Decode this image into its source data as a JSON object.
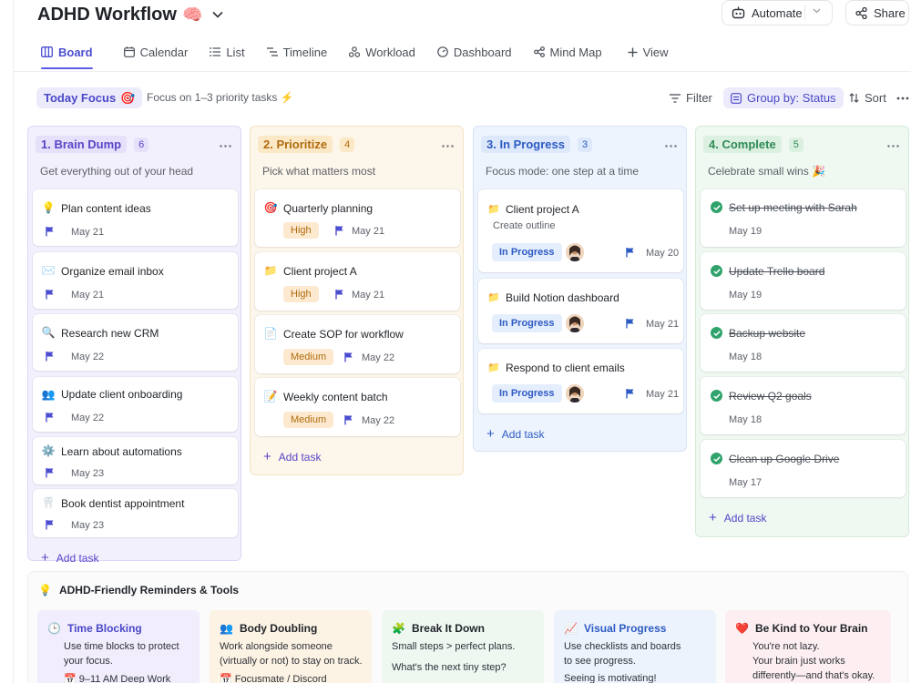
{
  "header": {
    "title": "ADHD Workflow",
    "emoji": "🧠",
    "automate_label": "Automate",
    "share_label": "Share"
  },
  "tabs": [
    {
      "label": "Board",
      "icon": "board-icon",
      "active": true
    },
    {
      "label": "Calendar",
      "icon": "calendar-icon"
    },
    {
      "label": "List",
      "icon": "list-icon"
    },
    {
      "label": "Timeline",
      "icon": "timeline-icon"
    },
    {
      "label": "Workload",
      "icon": "workload-icon"
    },
    {
      "label": "Dashboard",
      "icon": "dashboard-icon"
    },
    {
      "label": "Mind Map",
      "icon": "mindmap-icon"
    },
    {
      "label": "View",
      "icon": "plus-icon"
    }
  ],
  "toolbar": {
    "focus_label": "Today Focus",
    "focus_emoji": "🎯",
    "focus_text": "Focus on 1–3 priority tasks ⚡",
    "filter_label": "Filter",
    "group_label": "Group by: Status",
    "sort_label": "Sort"
  },
  "columns": [
    {
      "name": "1. Brain Dump",
      "count": "6",
      "subtitle": "Get everything out of your head",
      "cards": [
        {
          "icon": "💡",
          "title": "Plan content ideas",
          "date": "May 21"
        },
        {
          "icon": "✉️",
          "title": "Organize email inbox",
          "date": "May 21"
        },
        {
          "icon": "🔍",
          "title": "Research new CRM",
          "date": "May 22"
        },
        {
          "icon": "👥",
          "title": "Update client onboarding",
          "date": "May 22"
        },
        {
          "icon": "⚙️",
          "title": "Learn about automations",
          "date": "May 23"
        },
        {
          "icon": "🦷",
          "title": "Book dentist appointment",
          "date": "May 23"
        }
      ],
      "add_label": "Add task"
    },
    {
      "name": "2. Prioritize",
      "count": "4",
      "subtitle": "Pick what matters most",
      "cards": [
        {
          "icon": "🎯",
          "title": "Quarterly planning",
          "priority": "High",
          "date": "May 21"
        },
        {
          "icon": "📁",
          "title": "Client project A",
          "priority": "High",
          "date": "May 21"
        },
        {
          "icon": "📄",
          "title": "Create SOP for workflow",
          "priority": "Medium",
          "date": "May 22"
        },
        {
          "icon": "📝",
          "title": "Weekly content batch",
          "priority": "Medium",
          "date": "May 22"
        }
      ],
      "add_label": "Add task"
    },
    {
      "name": "3. In Progress",
      "count": "3",
      "subtitle": "Focus mode: one step at a time",
      "cards": [
        {
          "icon": "📁",
          "title": "Client project A",
          "description": "Create outline",
          "status": "In Progress",
          "date": "May 20"
        },
        {
          "icon": "📁",
          "title": "Build Notion dashboard",
          "status": "In Progress",
          "date": "May 21"
        },
        {
          "icon": "📁",
          "title": "Respond to client emails",
          "status": "In Progress",
          "date": "May 21"
        }
      ],
      "add_label": "Add task"
    },
    {
      "name": "4. Complete",
      "count": "5",
      "subtitle": "Celebrate small wins 🎉",
      "cards": [
        {
          "title": "Set up meeting with Sarah",
          "date": "May 19"
        },
        {
          "title": "Update Trello board",
          "date": "May 19"
        },
        {
          "title": "Backup website",
          "date": "May 18"
        },
        {
          "title": "Review Q2 goals",
          "date": "May 18"
        },
        {
          "title": "Clean up Google Drive",
          "date": "May 17"
        }
      ],
      "add_label": "Add task"
    }
  ],
  "tools": {
    "heading": "ADHD-Friendly Reminders & Tools",
    "cards": [
      {
        "icon": "🕒",
        "title": "Time Blocking",
        "lines": [
          "Use time blocks to protect",
          "your focus."
        ],
        "extra": "9–11 AM Deep Work",
        "extra_icon": "📅"
      },
      {
        "icon": "👥",
        "title": "Body Doubling",
        "lines": [
          "Work alongside someone",
          "(virtually or not) to stay on track."
        ],
        "extra": "Focusmate / Discord",
        "extra_icon": "📅"
      },
      {
        "icon": "🧩",
        "title": "Break It Down",
        "lines": [
          "Small steps > perfect plans.",
          "",
          "What's the next tiny step?"
        ]
      },
      {
        "icon": "📈",
        "title": "Visual Progress",
        "lines": [
          "Use checklists and boards",
          "to see progress.",
          "Seeing is motivating!"
        ]
      },
      {
        "icon": "❤️",
        "title": "Be Kind to Your Brain",
        "lines": [
          "You're not lazy.",
          "Your brain just works",
          "differently—and that's okay."
        ]
      }
    ]
  },
  "colors": {
    "accent": "#5b5ee6",
    "col1_bg": "#f3f0fd",
    "col1_border": "#ddd6f7",
    "col1_text": "#5845c8",
    "col2_bg": "#fdf6ea",
    "col2_border": "#f4e3c4",
    "col2_text": "#b06b0e",
    "col3_bg": "#eef4fd",
    "col3_border": "#d7e3f7",
    "col3_text": "#2d5bc4",
    "col4_bg": "#eff8f1",
    "col4_border": "#d5ebd9",
    "col4_text": "#2f8a56"
  }
}
